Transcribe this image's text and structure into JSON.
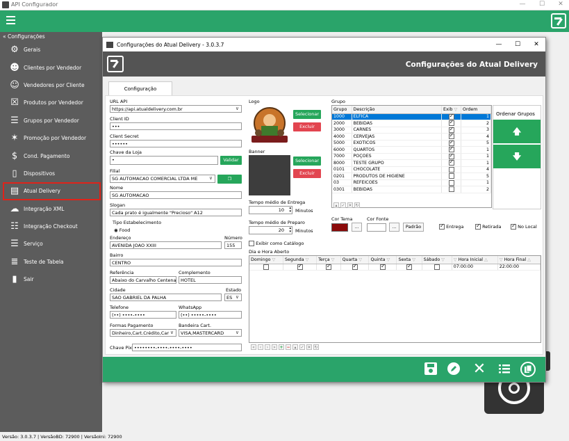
{
  "window": {
    "title": "API Configurador",
    "minimize": "—",
    "maximize": "☐",
    "close": "✕"
  },
  "sidebar": {
    "section": "« Configurações",
    "items": [
      {
        "label": "Gerais",
        "icon": "gears-icon",
        "glyph": "⚙"
      },
      {
        "label": "Clientes por Vendedor",
        "icon": "people-icon",
        "glyph": "☻"
      },
      {
        "label": "Vendedores por Cliente",
        "icon": "person-icon",
        "glyph": "☺"
      },
      {
        "label": "Produtos por Vendedor",
        "icon": "product-icon",
        "glyph": "☒"
      },
      {
        "label": "Grupos por Vendedor",
        "icon": "list-icon",
        "glyph": "☰"
      },
      {
        "label": "Promoção por Vendedor",
        "icon": "tag-icon",
        "glyph": "✶"
      },
      {
        "label": "Cond. Pagamento",
        "icon": "payment-icon",
        "glyph": "$"
      },
      {
        "label": "Dispositivos",
        "icon": "phone-icon",
        "glyph": "▯"
      },
      {
        "label": "Atual Delivery",
        "icon": "delivery-icon",
        "glyph": "▤"
      },
      {
        "label": "Integração XML",
        "icon": "cloud-icon",
        "glyph": "☁"
      },
      {
        "label": "Integração Checkout",
        "icon": "checkout-icon",
        "glyph": "☷"
      },
      {
        "label": "Serviço",
        "icon": "service-icon",
        "glyph": "☰"
      },
      {
        "label": "Teste de Tabela",
        "icon": "database-icon",
        "glyph": "≣"
      },
      {
        "label": "Sair",
        "icon": "exit-icon",
        "glyph": "▮"
      }
    ]
  },
  "status": "Versão: 3.0.3.7 | VersãoBD: 72900 | VersãoIni: 72900",
  "dialog": {
    "title": "Configurações do Atual Delivery - 3.0.3.7",
    "header": "Configurações do Atual Delivery",
    "tab": "Configuração",
    "form": {
      "url_api_label": "URL API",
      "url_api": "https://api.atualdelivery.com.br",
      "client_id_label": "Client ID",
      "client_id": "•••",
      "client_secret_label": "Client Secret",
      "client_secret": "••••••",
      "chave_loja_label": "Chave da Loja",
      "chave_loja": "•",
      "validar": "Validar",
      "filial_label": "Filial",
      "filial": "SG AUTOMACAO COMERCIAL LTDA ME",
      "capturar": "Capturar",
      "nome_label": "Nome",
      "nome": "SG AUTOMACAO",
      "slogan_label": "Slogan",
      "slogan": "Cada prato é igualmente \"Precioso\" A12",
      "tipo_label": "Tipo Estabelecimento",
      "tipo": "Food",
      "endereco_label": "Endereço",
      "endereco": "AVENIDA JOAO XXIII",
      "numero_label": "Número",
      "numero": "155",
      "bairro_label": "Bairro",
      "bairro": "CENTRO",
      "referencia_label": "Referência",
      "referencia": "Abaixo do Carvalho Centenar",
      "complemento_label": "Complemento",
      "complemento": "HOTEL",
      "cidade_label": "Cidade",
      "cidade": "SAO GABRIEL DA PALHA",
      "estado_label": "Estado",
      "estado": "ES",
      "telefone_label": "Telefone",
      "telefone": "(••) ••••-••••",
      "whatsapp_label": "WhatsApp",
      "whatsapp": "(••) •••••-••••",
      "formas_label": "Formas Pagamento",
      "formas": "Dinheiro,Cart.Crédito,Car",
      "bandeira_label": "Bandeira Cart.",
      "bandeira": "VISA,MASTERCARD",
      "pix_label": "Chave Pix",
      "pix": "••••••••-••••-••••-••••"
    },
    "logo_label": "Logo",
    "banner_label": "Banner",
    "selecionar": "Selecionar",
    "excluir": "Excluir",
    "entrega_label": "Tempo médio de Entrega",
    "entrega": "10",
    "preparo_label": "Tempo médio de Preparo",
    "preparo": "20",
    "minutos": "Minutos",
    "exibir_catalogo": "Exibir como Catálogo",
    "dia_hora_label": "Dia e Hora Aberto",
    "days": [
      "Domingo",
      "Segunda",
      "Terça",
      "Quarta",
      "Quinta",
      "Sexta",
      "Sábado"
    ],
    "days_checked": [
      false,
      true,
      true,
      true,
      true,
      true,
      false
    ],
    "hora_inicial_label": "Hora Inicial",
    "hora_final_label": "Hora Final",
    "hora_inicial": "07:00:00",
    "hora_final": "22:00:00",
    "grupo_label": "Grupo",
    "grupo_cols": [
      "Grupo",
      "Descrição",
      "Exib",
      "Ordem"
    ],
    "grupos": [
      {
        "g": "1000",
        "d": "ELFICA",
        "e": true,
        "o": "1"
      },
      {
        "g": "2000",
        "d": "BEBIDAS",
        "e": true,
        "o": "2"
      },
      {
        "g": "3000",
        "d": "CARNES",
        "e": true,
        "o": "3"
      },
      {
        "g": "4000",
        "d": "CERVEJAS",
        "e": true,
        "o": "4"
      },
      {
        "g": "5000",
        "d": "EXOTICOS",
        "e": true,
        "o": "5"
      },
      {
        "g": "6000",
        "d": "QUARTOS",
        "e": true,
        "o": "1"
      },
      {
        "g": "7000",
        "d": "POÇOES",
        "e": true,
        "o": "1"
      },
      {
        "g": "8000",
        "d": "TESTE GRUPO",
        "e": true,
        "o": "1"
      },
      {
        "g": "0101",
        "d": "CHOCOLATE",
        "e": false,
        "o": "4"
      },
      {
        "g": "0201",
        "d": "PRODUTOS DE HIGIENE",
        "e": false,
        "o": "5"
      },
      {
        "g": "03",
        "d": "REFEICOES",
        "e": false,
        "o": "1"
      },
      {
        "g": "0301",
        "d": "BEBIDAS",
        "e": false,
        "o": "2"
      }
    ],
    "ordenar_grupos": "Ordenar Grupos",
    "cor_tema_label": "Cor Tema",
    "cor_fonte_label": "Cor Fonte",
    "cor_tema": "#8b0a0a",
    "padrao": "Padrão",
    "entrega_chk": "Entrega",
    "retirada_chk": "Retirada",
    "nolocal_chk": "No Local"
  },
  "colors": {
    "brand_green": "#2aa46a",
    "dark_header": "#545454",
    "sidebar": "#5c5c5c",
    "danger": "#e24550"
  }
}
